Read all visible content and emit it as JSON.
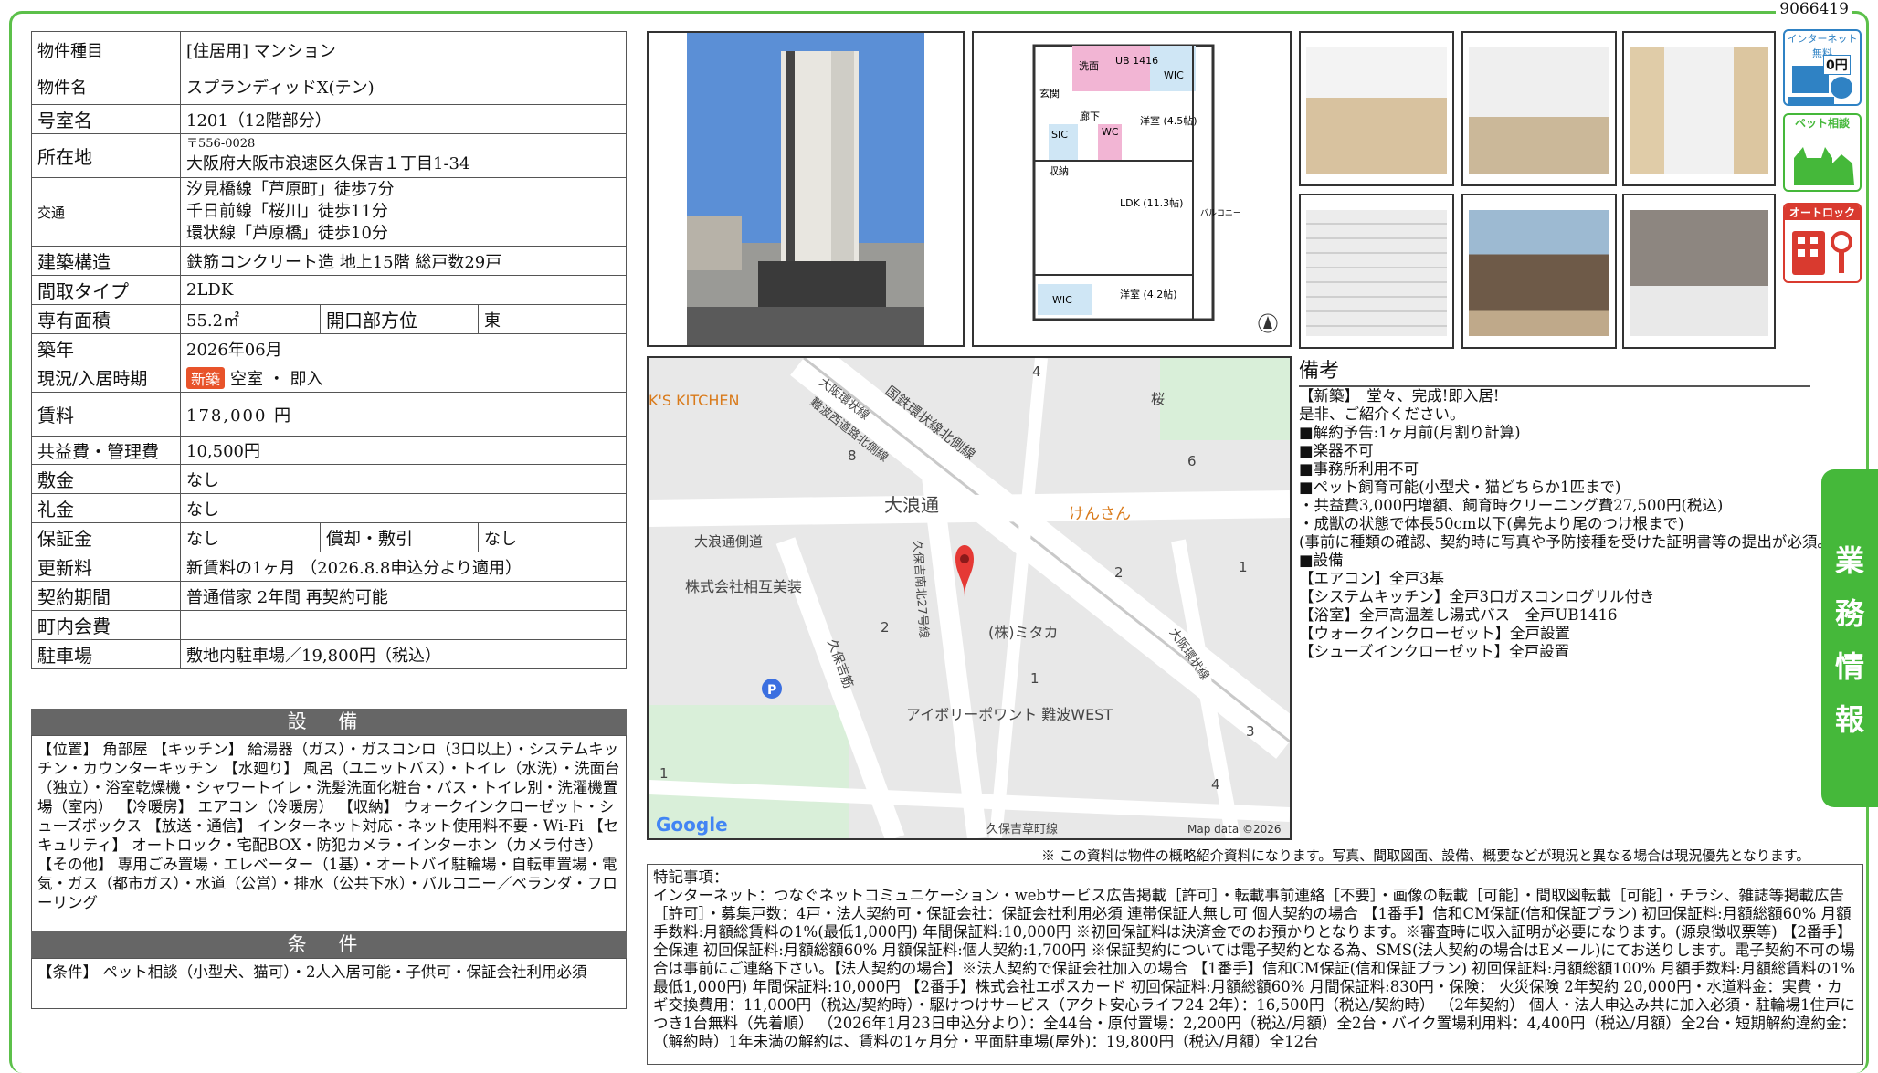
{
  "doc_id": "9066419",
  "spec": {
    "type_label": "物件種目",
    "type_value": "[住居用] マンション",
    "name_label": "物件名",
    "name_value": "スプランディッドX(テン)",
    "room_label": "号室名",
    "room_value": "1201（12階部分）",
    "addr_label": "所在地",
    "addr_zip": "〒556-0028",
    "addr_value": "大阪府大阪市浪速区久保吉１丁目1-34",
    "transit_label": "交通",
    "transit_lines": [
      "汐見橋線「芦原町」徒歩7分",
      "千日前線「桜川」徒歩11分",
      "環状線「芦原橋」徒歩10分"
    ],
    "structure_label": "建築構造",
    "structure_value": "鉄筋コンクリート造 地上15階 総戸数29戸",
    "layout_label": "間取タイプ",
    "layout_value": "2LDK",
    "area_label": "専有面積",
    "area_value": "55.2㎡",
    "dir_label": "開口部方位",
    "dir_value": "東",
    "built_label": "築年",
    "built_value": "2026年06月",
    "status_label": "現況/入居時期",
    "status_badge": "新築",
    "status_value": "空室 ・ 即入",
    "rent_label": "賃料",
    "rent_value": "178,000 円",
    "fee_label": "共益費・管理費",
    "fee_value": "10,500円",
    "deposit_label": "敷金",
    "deposit_value": "なし",
    "key_label": "礼金",
    "key_value": "なし",
    "guar_label": "保証金",
    "guar_value": "なし",
    "amort_label": "償却・敷引",
    "amort_value": "なし",
    "renew_label": "更新料",
    "renew_value": "新賃料の1ヶ月 （2026.8.8申込分より適用）",
    "contract_label": "契約期間",
    "contract_value": "普通借家 2年間 再契約可能",
    "town_label": "町内会費",
    "town_value": "",
    "parking_label": "駐車場",
    "parking_value": "敷地内駐車場／19,800円（税込）"
  },
  "equipment": {
    "title": "設 備",
    "text": "【位置】 角部屋 【キッチン】 給湯器（ガス）・ガスコンロ（3口以上）・システムキッチン・カウンターキッチン 【水廻り】 風呂（ユニットバス）・トイレ（水洗）・洗面台（独立）・浴室乾燥機・シャワートイレ・洗髪洗面化粧台・バス・トイレ別・洗濯機置場（室内） 【冷暖房】 エアコン（冷暖房） 【収納】 ウォークインクローゼット・シューズボックス 【放送・通信】 インターネット対応・ネット使用料不要・Wi-Fi 【セキュリティ】 オートロック・宅配BOX・防犯カメラ・インターホン（カメラ付き） 【その他】 専用ごみ置場・エレベーター（1基）・オートバイ駐輪場・自転車置場・電気・ガス（都市ガス）・水道（公営）・排水（公共下水）・バルコニー／ベランダ・フローリング"
  },
  "conditions": {
    "title": "条 件",
    "text": "【条件】 ペット相談（小型犬、猫可）・2人入居可能・子供可・保証会社利用必須"
  },
  "floorplan": {
    "rooms": [
      "洗面",
      "UB 1416",
      "WIC",
      "玄関",
      "廊下",
      "WC",
      "洋室 (4.5帖)",
      "SIC",
      "収納",
      "LDK (11.3帖)",
      "バルコニー",
      "WIC",
      "洋室 (4.2帖)"
    ]
  },
  "map": {
    "labels": [
      "国鉄環状線北側線",
      "大阪環状線",
      "難波西道路北側線",
      "大浪通",
      "けんさん",
      "大浪通側道",
      "株式会社相互美装",
      "(株)ミタカ",
      "アイボリーポワント 難波WEST",
      "久保吉筋",
      "久保吉南北27号線",
      "久保吉草町線",
      "桜",
      "K'S KITCHEN",
      "大阪環状線"
    ],
    "block_numbers": [
      "4",
      "8",
      "6",
      "2",
      "1",
      "2",
      "1",
      "3",
      "4",
      "1"
    ],
    "attribution": "Map data ©2026",
    "logo": "Google"
  },
  "notes": {
    "title": "備考",
    "text": "【新築】　堂々、完成!即入居!\n是非、ご紹介ください。\n■解約予告:1ヶ月前(月割り計算)\n■楽器不可\n■事務所利用不可\n■ペット飼育可能(小型犬・猫どちらか1匹まで)\n・共益費3,000円増額、飼育時クリーニング費27,500円(税込)\n・成獣の状態で体長50cm以下(鼻先より尾のつけ根まで)\n(事前に種類の確認、契約時に写真や予防接種を受けた証明書等の提出が必須。)\n■設備\n【エアコン】全戸3基\n【システムキッチン】全戸3口ガスコンログリル付き\n【浴室】全戸高温差し湯式バス　全戸UB1416\n【ウォークインクローゼット】全戸設置\n【シューズインクローゼット】全戸設置"
  },
  "disclaimer": "※ この資料は物件の概略紹介資料になります。写真、間取図面、設備、概要などが現況と異なる場合は現況優先となります。",
  "special": {
    "text": "特記事項：\nインターネット：つなぐネットコミュニケーション・webサービス広告掲載［許可］・転載事前連絡［不要］・画像の転載［可能］・間取図転載［可能］・チラシ、雑誌等掲載広告［許可］・募集戸数：4戸・法人契約可・保証会社：保証会社利用必須 連帯保証人無し可 個人契約の場合 【1番手】信和CM保証(信和保証プラン) 初回保証料:月額総額60% 月額手数料:月額総賃料の1%(最低1,000円) 年間保証料:10,000円 ※初回保証料は決済金でのお預かりとなります。※審査時に収入証明が必要になります。(源泉徴収票等) 【2番手】全保連 初回保証料:月額総額60% 月額保証料:個人契約:1,700円 ※保証契約については電子契約となる為、SMS(法人契約の場合はEメール)にてお送りします。電子契約不可の場合は事前にご連絡下さい。【法人契約の場合】※法人契約で保証会社加入の場合 【1番手】信和CM保証(信和保証プラン) 初回保証料:月額総額100% 月額手数料:月額総賃料の1%最低1,000円) 年間保証料:10,000円 【2番手】株式会社エポスカード 初回保証料:月額総額60% 月間保証料:830円・保険： 火災保険 2年契約 20,000円・水道料金：実費・カギ交換費用：11,000円（税込/契約時）・駆けつけサービス（アクト安心ライフ24 2年）：16,500円（税込/契約時） （2年契約） 個人・法人申込み共に加入必須・駐輪場1住戸につき1台無料（先着順） （2026年1月23日申込分より）：全44台・原付置場：2,200円（税込/月額）全2台・バイク置場利用料：4,400円（税込/月額）全2台・短期解約違約金：（解約時）1年未満の解約は、賃料の1ヶ月分・平面駐車場(屋外)：19,800円（税込/月額）全12台"
  },
  "side_icons": {
    "internet": "インターネット無料",
    "internet_price": "0円",
    "pet": "ペット相談",
    "autolock": "オートロック"
  },
  "side_tab": [
    "業",
    "務",
    "情",
    "報"
  ],
  "colors": {
    "frame": "#5cc04a",
    "tab": "#45b83a",
    "section_bar": "#666666",
    "new_badge": "#e8532a"
  }
}
